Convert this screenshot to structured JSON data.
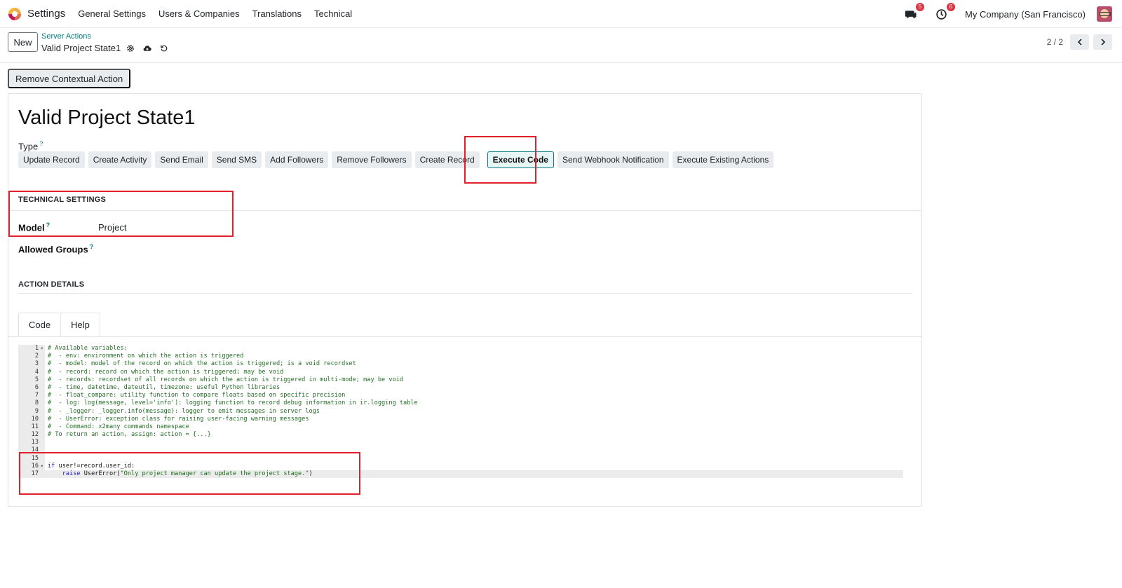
{
  "topbar": {
    "app_name": "Settings",
    "menu": [
      "General Settings",
      "Users & Companies",
      "Translations",
      "Technical"
    ],
    "chat_badge": "5",
    "activity_badge": "6",
    "company": "My Company (San Francisco)"
  },
  "controlbar": {
    "new_label": "New",
    "breadcrumb_parent": "Server Actions",
    "breadcrumb_current": "Valid Project State1",
    "pager": "2 / 2"
  },
  "actionbar": {
    "remove_label": "Remove Contextual Action"
  },
  "form": {
    "title": "Valid Project State1",
    "type_label": "Type",
    "help": "?",
    "types": [
      "Update Record",
      "Create Activity",
      "Send Email",
      "Send SMS",
      "Add Followers",
      "Remove Followers",
      "Create Record",
      "Execute Code",
      "Send Webhook Notification",
      "Execute Existing Actions"
    ],
    "active_type": "Execute Code",
    "technical_title": "TECHNICAL SETTINGS",
    "model_label": "Model",
    "model_value": "Project",
    "groups_label": "Allowed Groups",
    "details_title": "ACTION DETAILS",
    "tab_code": "Code",
    "tab_help": "Help"
  },
  "code_lines": [
    {
      "n": "1",
      "fold": true,
      "text": "# Available variables:"
    },
    {
      "n": "2",
      "text": "#  - env: environment on which the action is triggered"
    },
    {
      "n": "3",
      "text": "#  - model: model of the record on which the action is triggered; is a void recordset"
    },
    {
      "n": "4",
      "text": "#  - record: record on which the action is triggered; may be void"
    },
    {
      "n": "5",
      "text": "#  - records: recordset of all records on which the action is triggered in multi-mode; may be void"
    },
    {
      "n": "6",
      "text": "#  - time, datetime, dateutil, timezone: useful Python libraries"
    },
    {
      "n": "7",
      "text": "#  - float_compare: utility function to compare floats based on specific precision"
    },
    {
      "n": "8",
      "text": "#  - log: log(message, level='info'): logging function to record debug information in ir.logging table"
    },
    {
      "n": "9",
      "text": "#  - _logger: _logger.info(message): logger to emit messages in server logs"
    },
    {
      "n": "10",
      "text": "#  - UserError: exception class for raising user-facing warning messages"
    },
    {
      "n": "11",
      "text": "#  - Command: x2many commands namespace"
    },
    {
      "n": "12",
      "text": "# To return an action, assign: action = {...}"
    },
    {
      "n": "13",
      "text": ""
    },
    {
      "n": "14",
      "text": ""
    },
    {
      "n": "15",
      "text": ""
    }
  ],
  "code_if": {
    "n": "16",
    "kw": "if",
    "rest": " user!=record.user_id:"
  },
  "code_raise": {
    "n": "17",
    "kw": "raise",
    "mid": " UserError(",
    "str": "\"Only project manager can update the project stage.\"",
    "end": ")"
  }
}
